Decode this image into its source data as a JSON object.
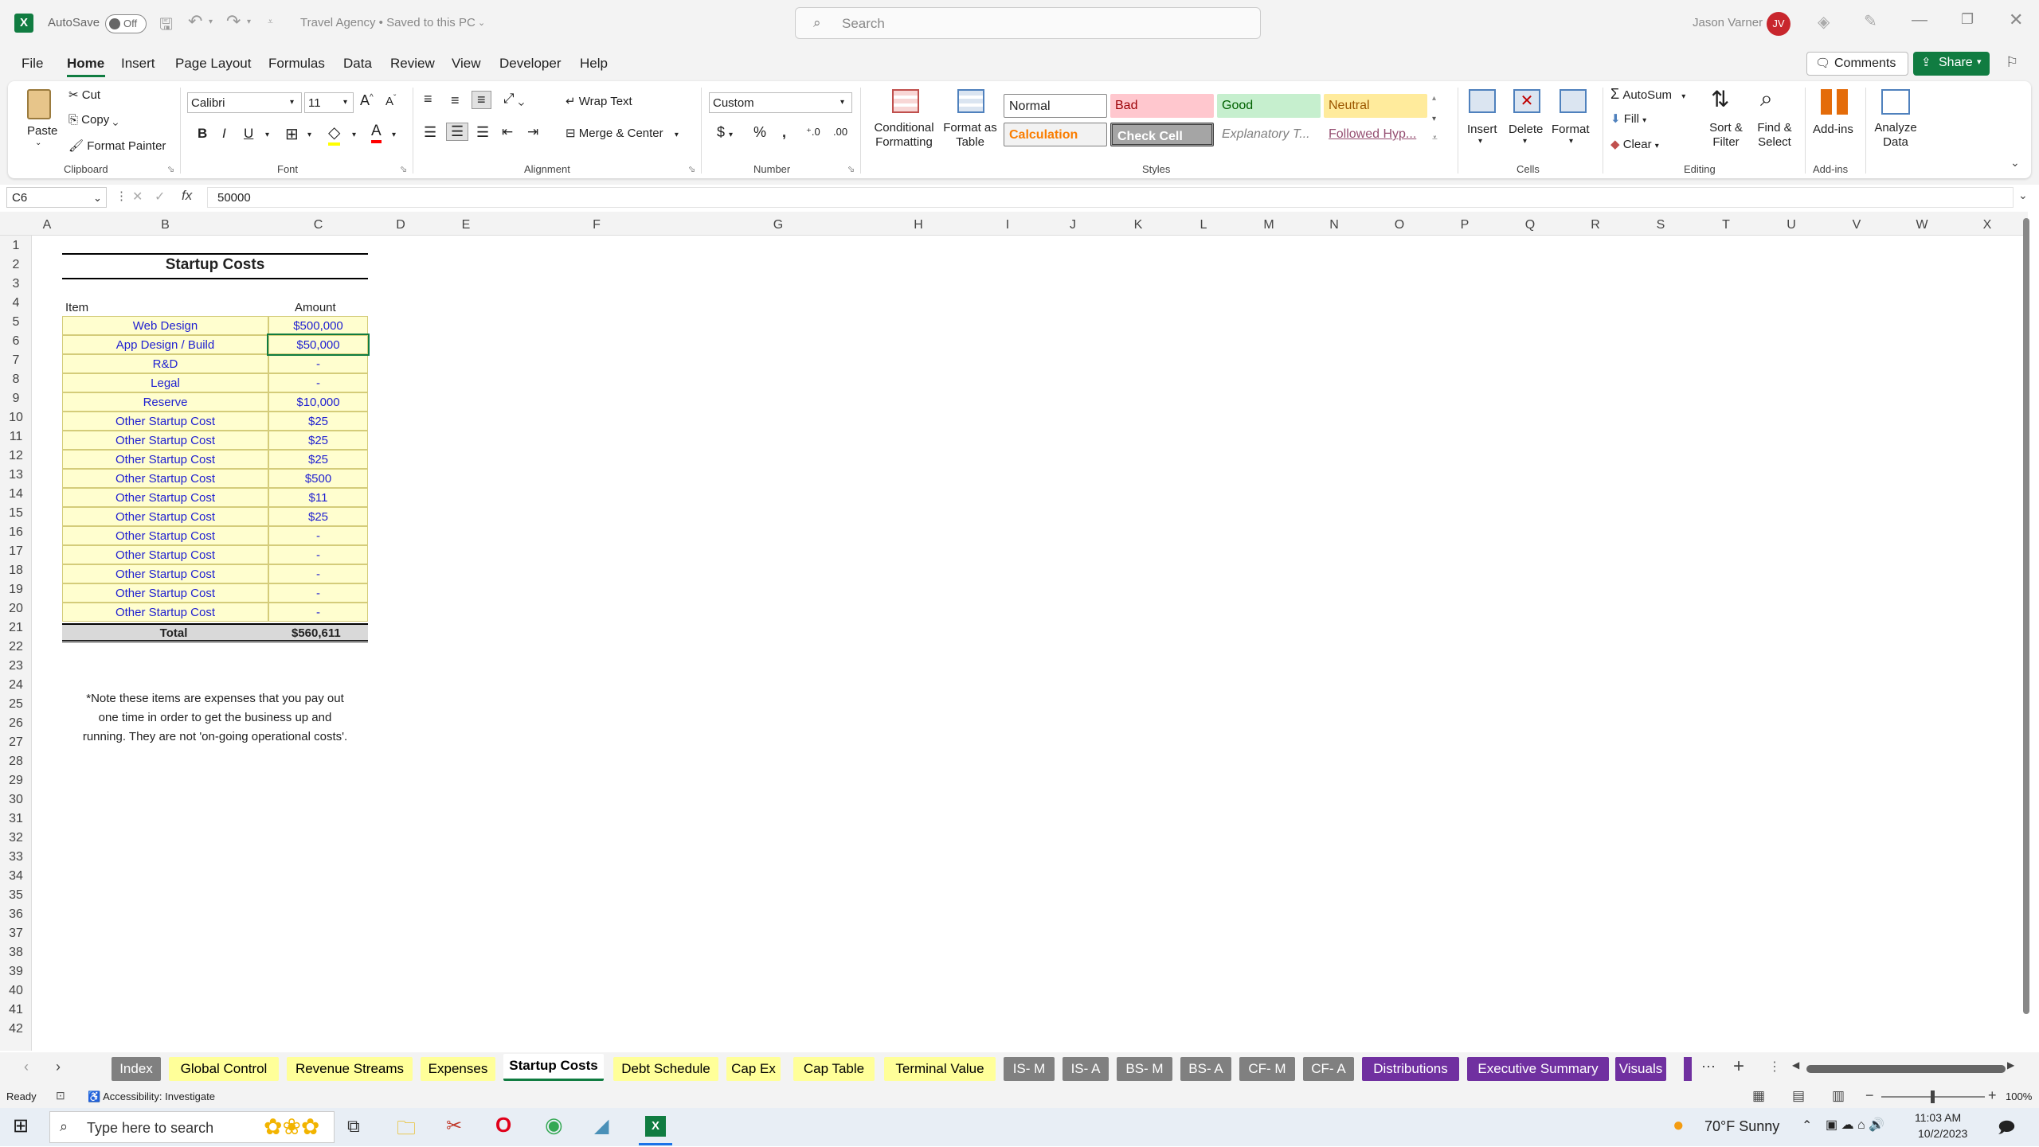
{
  "titlebar": {
    "autosave_label": "AutoSave",
    "autosave_state": "Off",
    "doc_title": "Travel Agency • Saved to this PC",
    "search_placeholder": "Search",
    "user_name": "Jason Varner",
    "user_initials": "JV"
  },
  "menu": [
    "File",
    "Home",
    "Insert",
    "Page Layout",
    "Formulas",
    "Data",
    "Review",
    "View",
    "Developer",
    "Help"
  ],
  "menu_active": "Home",
  "header_buttons": {
    "comments": "Comments",
    "share": "Share"
  },
  "ribbon": {
    "clipboard": {
      "paste": "Paste",
      "cut": "Cut",
      "copy": "Copy",
      "format_painter": "Format Painter",
      "group": "Clipboard"
    },
    "font": {
      "name": "Calibri",
      "size": "11",
      "group": "Font"
    },
    "alignment": {
      "wrap": "Wrap Text",
      "merge": "Merge & Center",
      "group": "Alignment"
    },
    "number": {
      "format": "Custom",
      "group": "Number"
    },
    "styles": {
      "cond_format": "Conditional Formatting",
      "format_table": "Format as Table",
      "group": "Styles",
      "items": [
        {
          "label": "Normal",
          "bg": "#ffffff",
          "color": "#000000"
        },
        {
          "label": "Bad",
          "bg": "#ffc7ce",
          "color": "#9c0006"
        },
        {
          "label": "Good",
          "bg": "#c6efce",
          "color": "#006100"
        },
        {
          "label": "Neutral",
          "bg": "#ffeb9c",
          "color": "#9c5700"
        },
        {
          "label": "Calculation",
          "bg": "#f2f2f2",
          "color": "#fa7d00"
        },
        {
          "label": "Check Cell",
          "bg": "#a5a5a5",
          "color": "#ffffff"
        },
        {
          "label": "Explanatory T...",
          "bg": "#ffffff",
          "color": "#7f7f7f"
        },
        {
          "label": "Followed Hyp...",
          "bg": "#ffffff",
          "color": "#954f72"
        }
      ]
    },
    "cells": {
      "insert": "Insert",
      "delete": "Delete",
      "format": "Format",
      "group": "Cells"
    },
    "editing": {
      "autosum": "AutoSum",
      "fill": "Fill",
      "clear": "Clear",
      "sort": "Sort & Filter",
      "find": "Find & Select",
      "group": "Editing"
    },
    "addins": {
      "addins": "Add-ins",
      "analyze": "Analyze Data",
      "group": "Add-ins"
    }
  },
  "formula_bar": {
    "name_box": "C6",
    "fx": "fx",
    "value": "50000"
  },
  "columns": [
    "A",
    "B",
    "C",
    "D",
    "E",
    "F",
    "G",
    "H",
    "I",
    "J",
    "K",
    "L",
    "M",
    "N",
    "O",
    "P",
    "Q",
    "R",
    "S",
    "T",
    "U",
    "V",
    "W",
    "X"
  ],
  "rows": [
    "1",
    "2",
    "3",
    "4",
    "5",
    "6",
    "7",
    "8",
    "9",
    "10",
    "11",
    "12",
    "13",
    "14",
    "15",
    "16",
    "17",
    "18",
    "19",
    "20",
    "21",
    "22",
    "23",
    "24",
    "25",
    "26",
    "27",
    "28",
    "29",
    "30",
    "31",
    "32",
    "33",
    "34",
    "35",
    "36",
    "37",
    "38",
    "39",
    "40",
    "41",
    "42"
  ],
  "sheet": {
    "title": "Startup Costs",
    "col_item": "Item",
    "col_amount": "Amount",
    "items": [
      {
        "item": "Web Design",
        "amount": "$500,000"
      },
      {
        "item": "App Design / Build",
        "amount": "$50,000"
      },
      {
        "item": "R&D",
        "amount": "-"
      },
      {
        "item": "Legal",
        "amount": "-"
      },
      {
        "item": "Reserve",
        "amount": "$10,000"
      },
      {
        "item": "Other Startup Cost",
        "amount": "$25"
      },
      {
        "item": "Other Startup Cost",
        "amount": "$25"
      },
      {
        "item": "Other Startup Cost",
        "amount": "$25"
      },
      {
        "item": "Other Startup Cost",
        "amount": "$500"
      },
      {
        "item": "Other Startup Cost",
        "amount": "$11"
      },
      {
        "item": "Other Startup Cost",
        "amount": "$25"
      },
      {
        "item": "Other Startup Cost",
        "amount": "-"
      },
      {
        "item": "Other Startup Cost",
        "amount": "-"
      },
      {
        "item": "Other Startup Cost",
        "amount": "-"
      },
      {
        "item": "Other Startup Cost",
        "amount": "-"
      },
      {
        "item": "Other Startup Cost",
        "amount": "-"
      }
    ],
    "total_label": "Total",
    "total_value": "$560,611",
    "note_lines": [
      "*Note these items are expenses that you pay out",
      "one time in order to get the business up and",
      "running. They are not 'on-going operational costs'."
    ]
  },
  "tabs": [
    {
      "label": "Index",
      "bg": "#808080",
      "color": "#ffffff"
    },
    {
      "label": "Global Control",
      "bg": "#ffff99",
      "color": "#000000"
    },
    {
      "label": "Revenue Streams",
      "bg": "#ffff99",
      "color": "#000000"
    },
    {
      "label": "Expenses",
      "bg": "#ffff99",
      "color": "#000000"
    },
    {
      "label": "Startup Costs",
      "bg": "#ffffff",
      "color": "#000000"
    },
    {
      "label": "Debt Schedule",
      "bg": "#ffff99",
      "color": "#000000"
    },
    {
      "label": "Cap Ex",
      "bg": "#ffff99",
      "color": "#000000"
    },
    {
      "label": "Cap Table",
      "bg": "#ffff99",
      "color": "#000000"
    },
    {
      "label": "Terminal Value",
      "bg": "#ffff99",
      "color": "#000000"
    },
    {
      "label": "IS- M",
      "bg": "#808080",
      "color": "#ffffff"
    },
    {
      "label": "IS- A",
      "bg": "#808080",
      "color": "#ffffff"
    },
    {
      "label": "BS- M",
      "bg": "#808080",
      "color": "#ffffff"
    },
    {
      "label": "BS- A",
      "bg": "#808080",
      "color": "#ffffff"
    },
    {
      "label": "CF- M",
      "bg": "#808080",
      "color": "#ffffff"
    },
    {
      "label": "CF- A",
      "bg": "#808080",
      "color": "#ffffff"
    },
    {
      "label": "Distributions",
      "bg": "#7030a0",
      "color": "#ffffff"
    },
    {
      "label": "Executive Summary",
      "bg": "#7030a0",
      "color": "#ffffff"
    },
    {
      "label": "Visuals",
      "bg": "#7030a0",
      "color": "#ffffff"
    }
  ],
  "active_tab": "Startup Costs",
  "status": {
    "ready": "Ready",
    "accessibility": "Accessibility: Investigate",
    "zoom": "100%"
  },
  "taskbar": {
    "search_placeholder": "Type here to search",
    "weather": "70°F  Sunny",
    "time": "11:03 AM",
    "date": "10/2/2023"
  }
}
